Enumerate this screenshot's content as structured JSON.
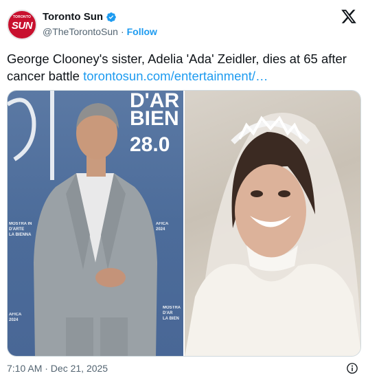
{
  "account": {
    "display_name": "Toronto Sun",
    "handle": "@TheTorontoSun",
    "separator": "·",
    "follow_label": "Follow",
    "avatar_top_text": "TORONTO",
    "avatar_text": "SUN",
    "brand_color": "#c8102e",
    "verified_icon": "verified-badge-icon"
  },
  "tweet": {
    "text": "George Clooney's sister, Adelia 'Ada' Zeidler, dies at 65 after cancer battle ",
    "link_text": "torontosun.com/entertainment/…"
  },
  "media": {
    "left_backdrop_lines": [
      "D'AR",
      "BIEN",
      "28.0"
    ],
    "left_backdrop_small": [
      "MOSTRA IN",
      "D'ARTE",
      "LA BIENNA",
      "AFICA",
      "2024"
    ],
    "left_backdrop_small2": [
      "MOSTRA",
      "D'AR",
      "LA BIEN"
    ],
    "left_backdrop_small3": [
      "AFICA",
      "2024"
    ]
  },
  "footer": {
    "timestamp": "7:10 AM · Dec 21, 2025"
  },
  "colors": {
    "link": "#1d9bf0",
    "secondary_text": "#536471",
    "primary_text": "#0f1419"
  }
}
